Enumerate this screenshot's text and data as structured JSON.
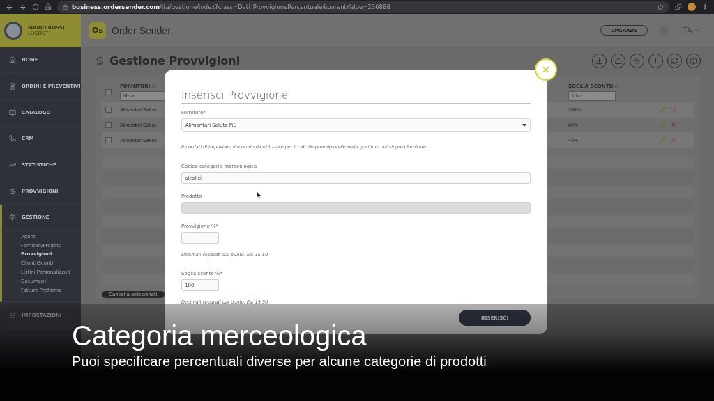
{
  "browser": {
    "url": "**business.ordersender.com**/ita/gestione/index?class=Dati_ProvvigionePercentuale&parentValue=236888"
  },
  "user": {
    "name": "MARIO ROSSI",
    "logout": "LOGOUT"
  },
  "nav": [
    {
      "label": "HOME",
      "selected": false
    },
    {
      "label": "ORDINI E PREVENTIVI",
      "selected": false
    },
    {
      "label": "CATALOGO",
      "selected": false
    },
    {
      "label": "CRM",
      "selected": false
    },
    {
      "label": "STATISTICHE",
      "selected": false
    },
    {
      "label": "PROVVIGIONI",
      "selected": false
    },
    {
      "label": "GESTIONE",
      "selected": true,
      "children": [
        {
          "label": "Agenti",
          "selected": false
        },
        {
          "label": "Fornitori/Prodotti",
          "selected": false
        },
        {
          "label": "Provvigioni",
          "selected": true
        },
        {
          "label": "Clienti/Sconti",
          "selected": false
        },
        {
          "label": "Listini Personalizzati",
          "selected": false
        },
        {
          "label": "Documenti",
          "selected": false
        },
        {
          "label": "Fatture Proforma",
          "selected": false
        }
      ]
    },
    {
      "label": "IMPOSTAZIONI",
      "selected": false
    }
  ],
  "header": {
    "logo_mark": "Os",
    "logo": "Order Sender",
    "upgrade": "UPGRADE",
    "language": "ITA"
  },
  "page": {
    "title": "Gestione Provvigioni"
  },
  "table": {
    "select_all_checked": false,
    "columns": [
      {
        "label": "FORNITORI",
        "placeholder": "filtra"
      },
      {
        "label": "SOGLIA SCONTO",
        "placeholder": "filtra"
      }
    ],
    "rows": [
      {
        "fornitore": "Alimentari Salute",
        "soglia": "100%",
        "checked": false
      },
      {
        "fornitore": "Alimentari Salute",
        "soglia": "60%",
        "checked": false
      },
      {
        "fornitore": "Alimentari Salute",
        "soglia": "40%",
        "checked": false
      }
    ],
    "bulk_button": "Cancella selezionati"
  },
  "modal": {
    "title": "Inserisci Provvigione",
    "fields": [
      {
        "kind": "select",
        "label": "Fornitore*",
        "value": "Alimentari Salute Più"
      },
      {
        "kind": "note",
        "text": "Ricordati di impostare il metodo da utilizzare per il calcolo provvigionale nella gestione del singolo fornitore."
      },
      {
        "kind": "text",
        "label": "Codice categoria merceologica",
        "value": "alcolici"
      },
      {
        "kind": "disabled",
        "label": "Prodotto"
      },
      {
        "kind": "small",
        "label": "Provvigione %*"
      },
      {
        "kind": "note",
        "text": "Decimali separati dal punto. Es: 15.50"
      },
      {
        "kind": "small",
        "label": "Soglia sconto %*",
        "value": "100"
      },
      {
        "kind": "note",
        "text": "Decimali separati dal punto. Es: 15.50"
      }
    ],
    "submit": "INSERISCI"
  },
  "caption": {
    "title": "Categoria merceologica",
    "subtitle": "Puoi specificare percentuali diverse per alcune categorie di prodotti"
  }
}
